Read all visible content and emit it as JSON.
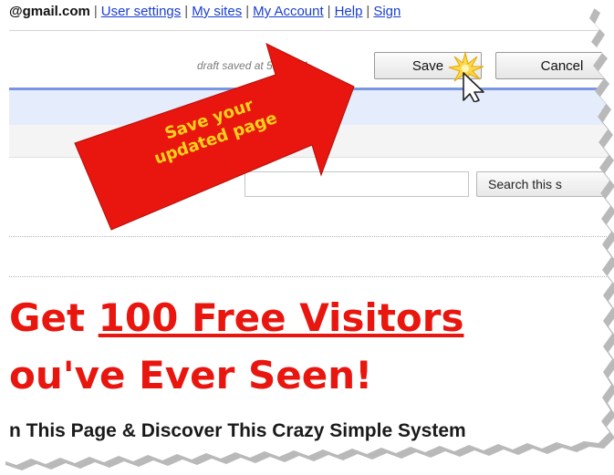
{
  "topbar": {
    "email": "@gmail.com",
    "links": [
      "User settings",
      "My sites",
      "My Account",
      "Help",
      "Sign"
    ]
  },
  "editor": {
    "draft_status": "draft saved at 5:44 PM",
    "save_label": "Save",
    "cancel_label": "Cancel"
  },
  "search": {
    "value": "",
    "button_label": "Search this s"
  },
  "page": {
    "headline_prefix": "Get ",
    "headline_link": "100 Free Visitors",
    "headline_line2": "ou've Ever Seen!",
    "subheadline": "n This Page & Discover This Crazy Simple System"
  },
  "callout": {
    "line1": "Save your",
    "line2": "updated page"
  },
  "colors": {
    "arrow_red": "#e8160e",
    "arrow_text": "#ffd21a",
    "headline_red": "#e8160e",
    "link_blue": "#1a3fd0",
    "blue_rule": "#7b96e0"
  },
  "icons": {
    "cursor": "mouse-pointer-icon",
    "sparkle": "click-burst-icon"
  }
}
